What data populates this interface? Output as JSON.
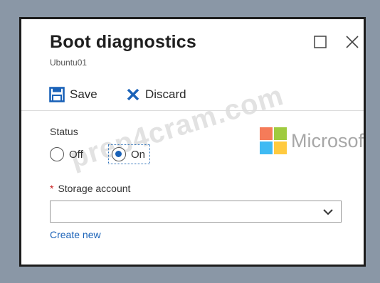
{
  "blade": {
    "title": "Boot diagnostics",
    "subtitle": "Ubuntu01"
  },
  "toolbar": {
    "save_label": "Save",
    "discard_label": "Discard"
  },
  "status": {
    "label": "Status",
    "options": [
      {
        "label": "Off",
        "selected": false
      },
      {
        "label": "On",
        "selected": true
      }
    ]
  },
  "storage": {
    "required_marker": "*",
    "label": "Storage account",
    "value": "",
    "create_link": "Create new"
  },
  "watermark": {
    "text": "prep4cram.com",
    "logo_text": "Microsoft"
  },
  "colors": {
    "accent": "#1a62b8",
    "required": "#c81e1e",
    "ms_red": "#f25022",
    "ms_green": "#7fba00",
    "ms_blue": "#00a4ef",
    "ms_yellow": "#ffb900"
  },
  "icons": {
    "save": "save-icon",
    "discard": "discard-x-icon",
    "maximize": "maximize-icon",
    "close": "close-icon",
    "dropdown": "chevron-down-icon"
  }
}
